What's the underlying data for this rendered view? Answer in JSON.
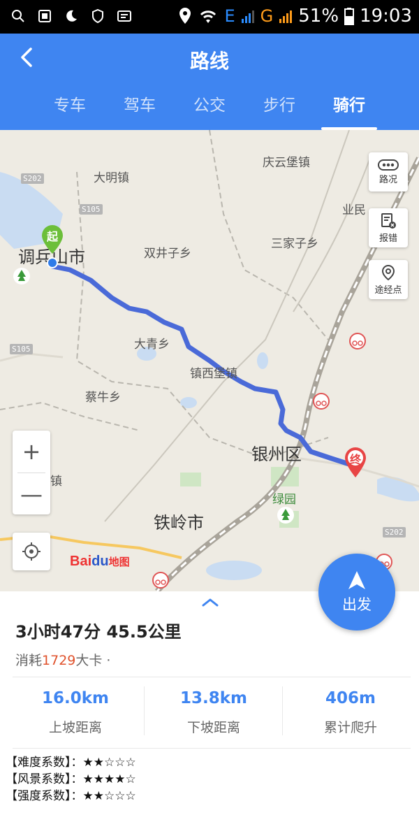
{
  "status_bar": {
    "network_1": "E",
    "network_2": "G",
    "battery": "51%",
    "time": "19:03"
  },
  "header": {
    "title": "路线",
    "tabs": [
      {
        "label": "专车",
        "active": false
      },
      {
        "label": "驾车",
        "active": false
      },
      {
        "label": "公交",
        "active": false
      },
      {
        "label": "步行",
        "active": false
      },
      {
        "label": "骑行",
        "active": true
      }
    ]
  },
  "map": {
    "places": {
      "qingyun": "庆云堡镇",
      "daming": "大明镇",
      "yebao": "业民",
      "sanjiazi": "三家子乡",
      "diaobingshan": "调兵山市",
      "shuangjingzi": "双井子乡",
      "daqing": "大青乡",
      "zhenxibao": "镇西堡镇",
      "cainiu": "蔡牛乡",
      "yinzhou": "银州区",
      "zhen": "镇",
      "lvyuan": "绿园",
      "tieling": "铁岭市"
    },
    "road_tags": [
      "S202",
      "S105",
      "S105",
      "S202"
    ],
    "start_marker": "起",
    "end_marker": "终",
    "side_buttons": {
      "traffic": "路况",
      "report": "报错",
      "waypoint": "途经点"
    },
    "zoom_in": "+",
    "zoom_out": "—",
    "logo": {
      "bai": "Bai",
      "du": "du",
      "ditu": "地图"
    },
    "go_button": "出发"
  },
  "summary": {
    "duration_distance": "3小时47分  45.5公里",
    "calorie_prefix": "消耗",
    "calorie_value": "1729",
    "calorie_suffix": "大卡 ·",
    "stats": [
      {
        "value": "16.0km",
        "label": "上坡距离"
      },
      {
        "value": "13.8km",
        "label": "下坡距离"
      },
      {
        "value": "406m",
        "label": "累计爬升"
      }
    ]
  },
  "ratings": [
    {
      "text": "【难度系数】：★★☆☆☆"
    },
    {
      "text": "【风景系数】：★★★★☆"
    },
    {
      "text": "【强度系数】：★★☆☆☆"
    }
  ],
  "colors": {
    "accent": "#3f85f1",
    "route": "#4a6ad8",
    "start": "#6cbf3a",
    "end": "#e84545",
    "calorie": "#e0522c"
  }
}
